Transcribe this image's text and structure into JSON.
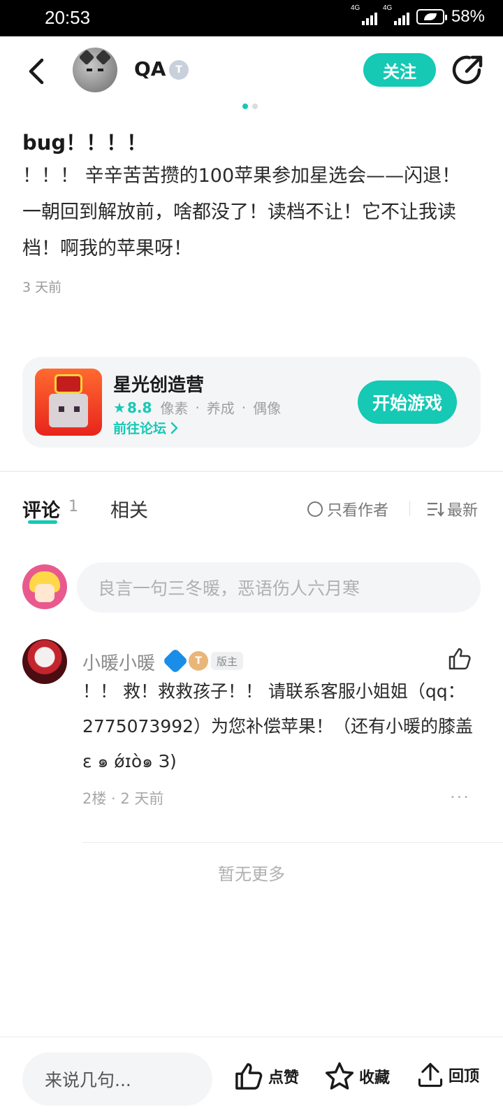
{
  "status_bar": {
    "time": "20:53",
    "network_1": "4G",
    "network_2": "4G",
    "battery": "58%"
  },
  "header": {
    "username": "QA",
    "level_badge": "T",
    "follow_label": "关注"
  },
  "post": {
    "title": "bug！！！！",
    "body": "！！！ 辛辛苦苦攒的100苹果参加星选会——闪退！\n一朝回到解放前，啥都没了！读档不让！它不让我读档！啊我的苹果呀！",
    "time": "3 天前"
  },
  "game_card": {
    "name": "星光创造营",
    "score": "8.8",
    "tags": [
      "像素",
      "养成",
      "偶像"
    ],
    "forum_link": "前往论坛",
    "play_label": "开始游戏",
    "accent": "#15c9b4"
  },
  "tabs": {
    "comments_label": "评论",
    "comments_count": "1",
    "related_label": "相关",
    "author_only": "只看作者",
    "sort": "最新"
  },
  "compose": {
    "placeholder": "良言一句三冬暖，恶语伤人六月寒"
  },
  "comments": [
    {
      "name": "小暖小暖",
      "badge_t": "T",
      "mod_badge": "版主",
      "text": "！！ 救！救救孩子！！ 请联系客服小姐姐（qq：2775073992）为您补偿苹果！（还有小暖的膝盖ε ๑ ǿɪò๑ З)",
      "meta": "2楼 · 2 天前",
      "more": "···"
    }
  ],
  "no_more": "暂无更多",
  "bottom_bar": {
    "input_placeholder": "来说几句...",
    "like_label": "点赞",
    "favorite_label": "收藏",
    "top_label": "回顶"
  }
}
